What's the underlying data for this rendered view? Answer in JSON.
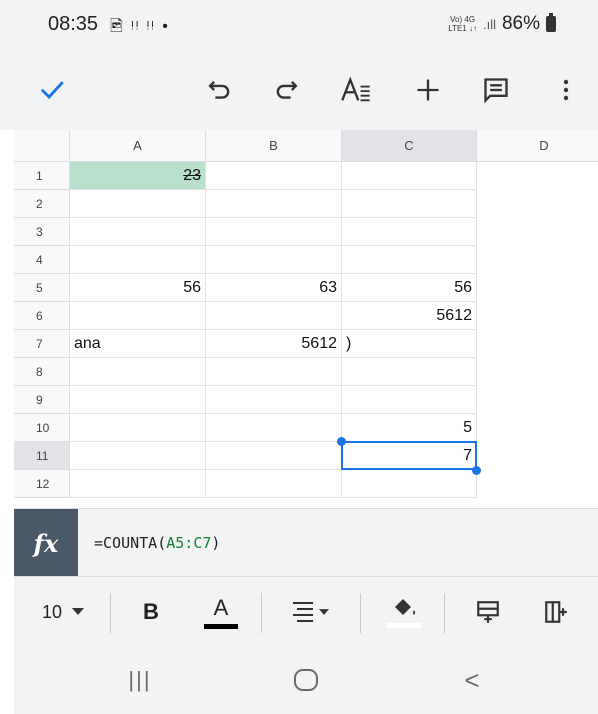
{
  "status_bar": {
    "time": "08:35",
    "notif_icons": "🖻 ᵎᵎ ᵎᵎ •",
    "net_top": "Vo) 4G",
    "net_bottom": "LTE1 ↓↑",
    "signal": ".ıll",
    "battery": "86%"
  },
  "toolbar": {
    "icons": [
      "check-icon",
      "undo-icon",
      "redo-icon",
      "text-format-icon",
      "add-icon",
      "comment-icon",
      "more-vert-icon"
    ],
    "accent_color": "#1a73e8"
  },
  "sheet": {
    "columns": [
      "A",
      "B",
      "C",
      "D"
    ],
    "rows": [
      "1",
      "2",
      "3",
      "4",
      "5",
      "6",
      "7",
      "8",
      "9",
      "10",
      "11",
      "12"
    ],
    "selected_column": "C",
    "selected_row": "11",
    "cells": {
      "A1": "23",
      "A5": "56",
      "B5": "63",
      "C5": "56",
      "C6": "5612",
      "A7": "ana",
      "B7": "5612",
      "C7": ")",
      "C10": "5",
      "C11": "7"
    },
    "highlight_color": "#b7e1cd"
  },
  "formula_bar": {
    "fx_label": "fx",
    "formula_prefix": "=COUNTA(",
    "formula_range": "A5:C7",
    "formula_suffix": ")"
  },
  "format_toolbar": {
    "font_size": "10",
    "bold_label": "B",
    "text_color_label": "A",
    "icons": [
      "dropdown-icon",
      "bold-icon",
      "text-color-icon",
      "align-icon",
      "fill-color-icon",
      "insert-row-icon",
      "insert-column-icon"
    ]
  },
  "nav_bar": {
    "recents": "|||",
    "back": "<"
  }
}
